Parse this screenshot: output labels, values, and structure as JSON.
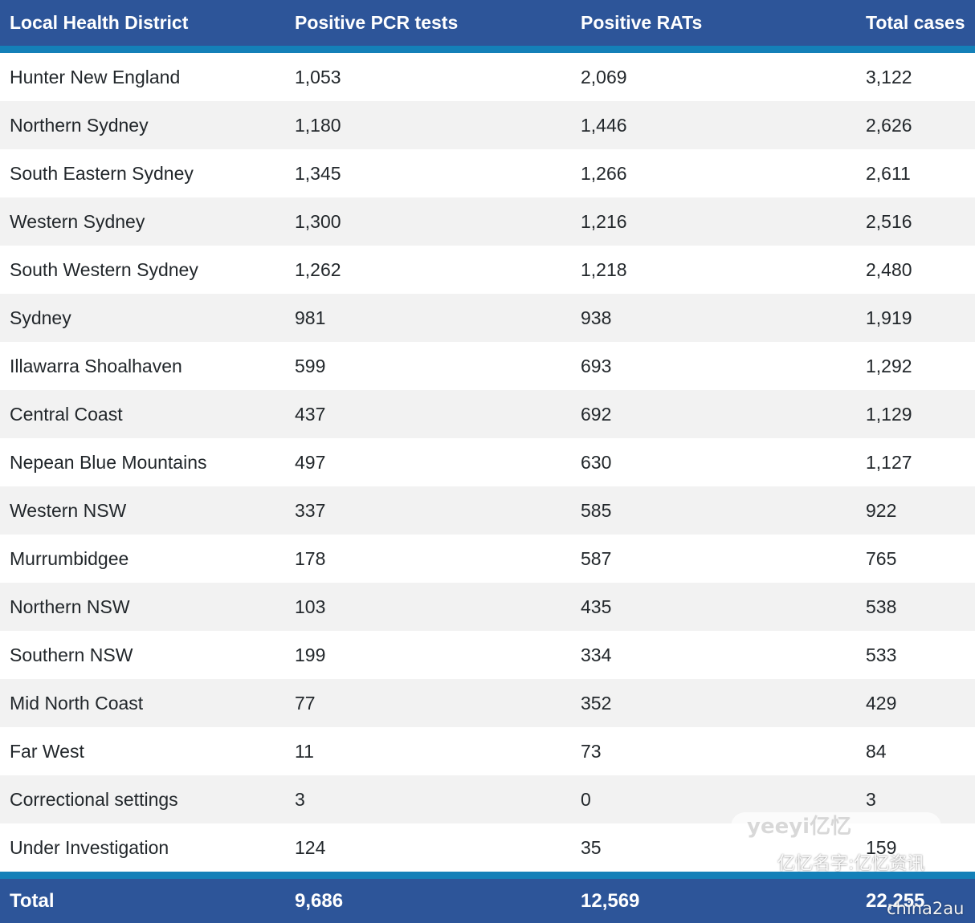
{
  "table": {
    "headers": [
      "Local Health District",
      "Positive PCR tests",
      "Positive RATs",
      "Total cases"
    ],
    "rows": [
      [
        "Hunter New England",
        "1,053",
        "2,069",
        "3,122"
      ],
      [
        "Northern Sydney",
        "1,180",
        "1,446",
        "2,626"
      ],
      [
        "South Eastern Sydney",
        "1,345",
        "1,266",
        "2,611"
      ],
      [
        "Western Sydney",
        "1,300",
        "1,216",
        "2,516"
      ],
      [
        "South Western Sydney",
        "1,262",
        "1,218",
        "2,480"
      ],
      [
        "Sydney",
        "981",
        "938",
        "1,919"
      ],
      [
        "Illawarra Shoalhaven",
        "599",
        "693",
        "1,292"
      ],
      [
        "Central Coast",
        "437",
        "692",
        "1,129"
      ],
      [
        "Nepean Blue Mountains",
        "497",
        "630",
        "1,127"
      ],
      [
        "Western NSW",
        "337",
        "585",
        "922"
      ],
      [
        "Murrumbidgee",
        "178",
        "587",
        "765"
      ],
      [
        "Northern NSW",
        "103",
        "435",
        "538"
      ],
      [
        "Southern NSW",
        "199",
        "334",
        "533"
      ],
      [
        "Mid North Coast",
        "77",
        "352",
        "429"
      ],
      [
        "Far West",
        "11",
        "73",
        "84"
      ],
      [
        "Correctional settings",
        "3",
        "0",
        "3"
      ],
      [
        "Under Investigation",
        "124",
        "35",
        "159"
      ]
    ],
    "total": [
      "Total",
      "9,686",
      "12,569",
      "22,255"
    ]
  },
  "watermark": {
    "logo": "yeeyi亿忆",
    "line1": "亿忆名字:亿忆资讯",
    "line2": "chinа2au"
  },
  "colors": {
    "header_bg": "#2d5599",
    "accent_rule": "#1480b8",
    "stripe": "#f2f2f2"
  }
}
